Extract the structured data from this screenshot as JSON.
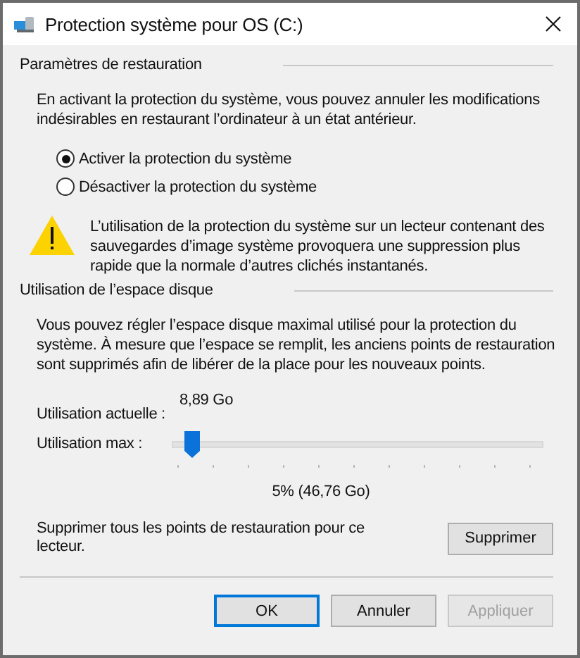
{
  "window": {
    "title": "Protection système pour OS (C:)"
  },
  "restore_settings": {
    "heading": "Paramètres de restauration",
    "description": "En activant la protection du système, vous pouvez annuler les modifications indésirables en restaurant l’ordinateur à un état antérieur.",
    "options": [
      {
        "label": "Activer la protection du système",
        "selected": true
      },
      {
        "label": "Désactiver la protection du système",
        "selected": false
      }
    ],
    "warning": "L’utilisation de la protection du système sur un lecteur contenant des sauvegardes d’image système provoquera une suppression plus rapide que la normale d’autres clichés instantanés."
  },
  "disk_usage": {
    "heading": "Utilisation de l’espace disque",
    "description": "Vous pouvez régler l’espace disque maximal utilisé pour la protection du système. À mesure que l’espace se remplit, les anciens points de restauration sont supprimés afin de libérer de la place pour les nouveaux points.",
    "current_label": "Utilisation actuelle :",
    "current_value": "8,89 Go",
    "max_label": "Utilisation max :",
    "max_slider": {
      "level": 0.05
    },
    "max_reading": "5% (46,76 Go)",
    "delete_text": "Supprimer tous les points de restauration pour ce lecteur.",
    "delete_button": "Supprimer"
  },
  "buttons": [
    {
      "label": "OK",
      "focused": true,
      "disabled": false
    },
    {
      "label": "Annuler",
      "focused": false,
      "disabled": false
    },
    {
      "label": "Appliquer",
      "focused": false,
      "disabled": true
    }
  ]
}
